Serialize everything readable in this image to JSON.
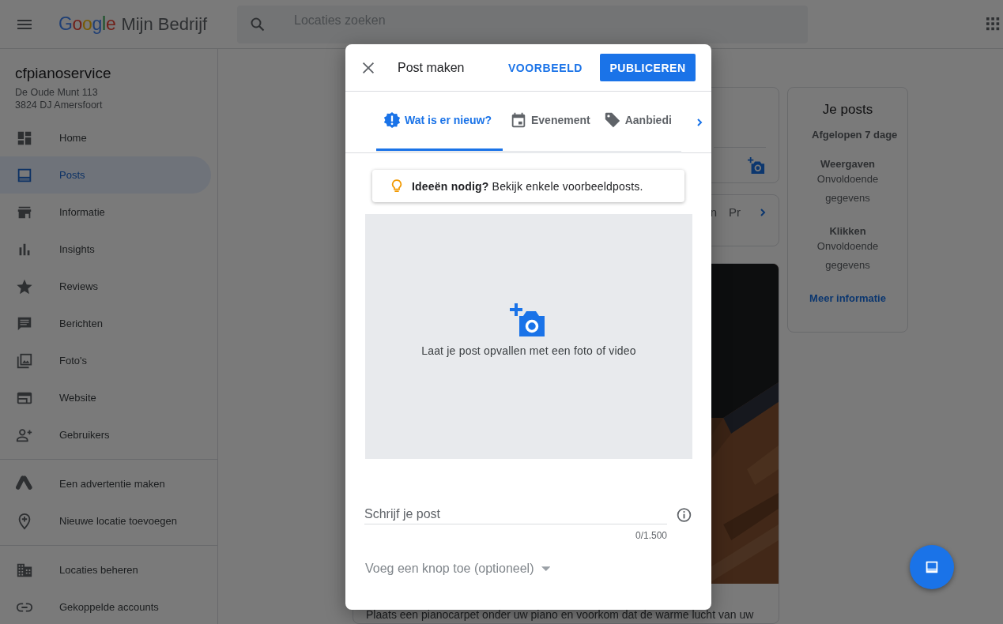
{
  "header": {
    "logo": "Google",
    "product": "Mijn Bedrijf",
    "search": {
      "placeholder": "Locaties zoeken"
    }
  },
  "sidebar": {
    "business": {
      "name": "cfpianoservice",
      "address": [
        "De Oude Munt 113",
        "3824 DJ Amersfoort"
      ]
    },
    "sections": [
      {
        "items": [
          {
            "label": "Home",
            "kind": "dashboard",
            "selected": false
          },
          {
            "label": "Posts",
            "kind": "post",
            "selected": true
          },
          {
            "label": "Informatie",
            "kind": "store",
            "selected": false
          },
          {
            "label": "Insights",
            "kind": "bars",
            "selected": false
          },
          {
            "label": "Reviews",
            "kind": "star",
            "selected": false
          },
          {
            "label": "Berichten",
            "kind": "message",
            "selected": false
          },
          {
            "label": "Foto's",
            "kind": "photos",
            "selected": false
          },
          {
            "label": "Website",
            "kind": "web",
            "selected": false
          },
          {
            "label": "Gebruikers",
            "kind": "person-add",
            "selected": false
          }
        ]
      },
      {
        "items": [
          {
            "label": "Een advertentie maken",
            "kind": "ads",
            "selected": false
          },
          {
            "label": "Nieuwe locatie toevoegen",
            "kind": "add-location",
            "selected": false
          }
        ]
      },
      {
        "items": [
          {
            "label": "Locaties beheren",
            "kind": "building",
            "selected": false
          },
          {
            "label": "Gekoppelde accounts",
            "kind": "link",
            "selected": false
          }
        ]
      }
    ]
  },
  "main": {
    "tabs_card": {
      "labels": [
        "n",
        "Pr"
      ]
    },
    "post_card": {
      "text": "Plaats een pianocarpet onder uw piano en voorkom dat de warme lucht van uw"
    },
    "stats": {
      "title": "Je posts",
      "period": "Afgelopen 7 dage",
      "metrics": [
        {
          "label": "Weergaven",
          "value": "Onvoldoende gegevens"
        },
        {
          "label": "Klikken",
          "value": "Onvoldoende gegevens"
        }
      ],
      "link": "Meer informatie"
    }
  },
  "dialog": {
    "title": "Post maken",
    "preview": "VOORBEELD",
    "publish": "PUBLICEREN",
    "tabs": [
      {
        "label": "Wat is er nieuw?",
        "kind": "news",
        "selected": true
      },
      {
        "label": "Evenement",
        "kind": "event",
        "selected": false
      },
      {
        "label": "Aanbiedi",
        "kind": "offer",
        "selected": false
      }
    ],
    "ideas": "**Ideeën nodig?** Bekijk enkele voorbeeldposts.",
    "media_prompt": "Laat je post opvallen met een foto of video",
    "post_field": {
      "placeholder": "Schrijf je post"
    },
    "counter": "0/1.500",
    "button_select": {
      "placeholder": "Voeg een knop toe (optioneel)"
    }
  }
}
